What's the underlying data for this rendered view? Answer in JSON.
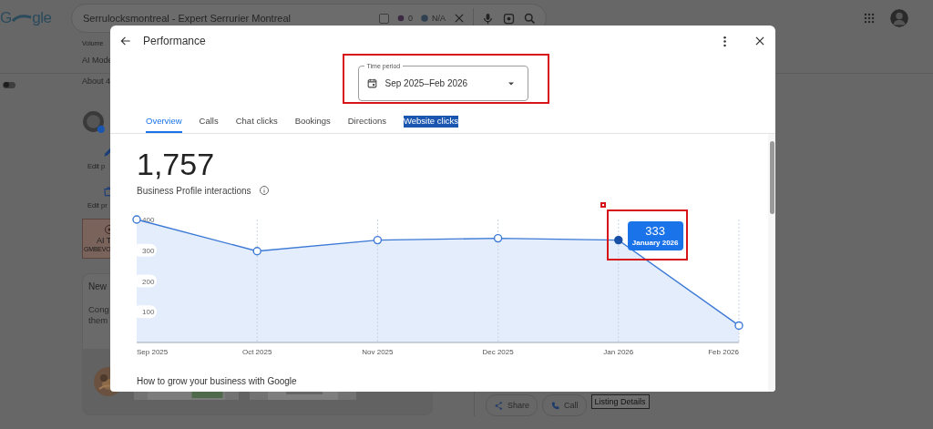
{
  "background_page": {
    "logo": {
      "first_letter": "G",
      "rest": "gle"
    },
    "search_bar": {
      "query": "Serrulocksmontreal - Expert Serrurier Montreal",
      "checked": false,
      "count": "0",
      "value": "N/A"
    },
    "volume_label": "Volume",
    "ai_mode_tab": "AI Mode",
    "results_count": "About 4",
    "toggle": {
      "on": false
    },
    "actions": [
      {
        "label": "Edit p",
        "kind": "pencil"
      },
      {
        "label": "Edit pr",
        "kind": "product"
      }
    ],
    "promo_card": {
      "title": "AI T",
      "subtitle": "GMBEVO"
    },
    "notice_card": {
      "title": "New",
      "body_lines": [
        "Cong",
        "them"
      ]
    },
    "listing_buttons": [
      {
        "label": "Share",
        "kind": "share"
      },
      {
        "label": "Call",
        "kind": "call"
      }
    ],
    "listing_details": "Listing Details"
  },
  "dialog": {
    "title": "Performance",
    "time_period": {
      "label": "Time period",
      "value": "Sep 2025–Feb 2026"
    },
    "tabs": [
      {
        "label": "Overview",
        "selected": true,
        "text_highlighted": false
      },
      {
        "label": "Calls",
        "selected": false,
        "text_highlighted": false
      },
      {
        "label": "Chat clicks",
        "selected": false,
        "text_highlighted": false
      },
      {
        "label": "Bookings",
        "selected": false,
        "text_highlighted": false
      },
      {
        "label": "Directions",
        "selected": false,
        "text_highlighted": false
      },
      {
        "label": "Website clicks",
        "selected": false,
        "text_highlighted": true
      }
    ],
    "total": "1,757",
    "chart_data": {
      "type": "area",
      "grid": true,
      "categories": [
        "Sep 2025",
        "Oct 2025",
        "Nov 2025",
        "Dec 2025",
        "Jan 2026",
        "Feb 2026"
      ],
      "series": [
        {
          "name": "Business Profile interactions",
          "color": "#3d7ad6",
          "values": [
            400,
            297,
            333,
            339,
            333,
            55
          ]
        }
      ],
      "ylim": [
        0,
        400
      ],
      "yticks": [
        100,
        200,
        300,
        400
      ],
      "annotations": [
        {
          "x": "Jan 2026",
          "y": 333,
          "text": "333"
        }
      ]
    },
    "tooltip_label": "January 2026",
    "next_section_title": "How to grow your business with Google"
  }
}
